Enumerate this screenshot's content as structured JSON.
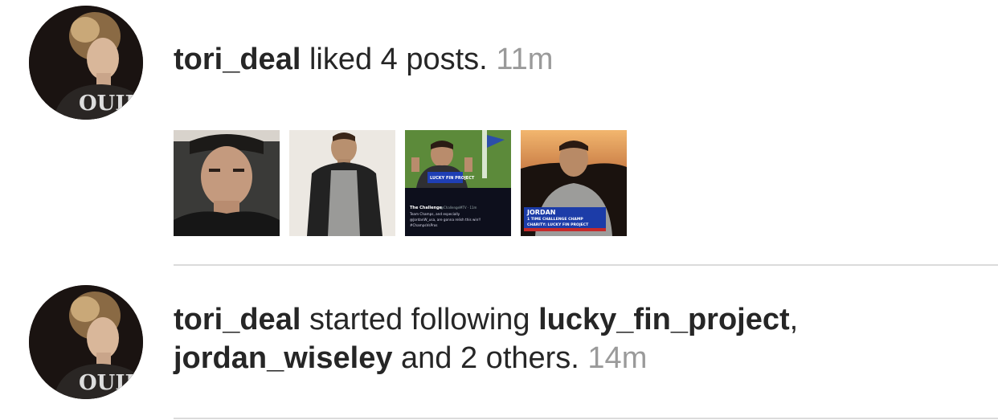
{
  "notifications": [
    {
      "username": "tori_deal",
      "action": "liked 4 posts.",
      "time": "11m",
      "avatar_icon": "profile-photo",
      "avatar_shirt_text": "OUIJ",
      "posts": [
        {
          "icon": "portrait-photo-1"
        },
        {
          "icon": "portrait-photo-2"
        },
        {
          "icon": "screenshot-photo-3",
          "banner": "LUCKY FIN PROJECT",
          "tweet_author": "The Challenge",
          "tweet_handle": "@ChallengeMTV · 11m",
          "tweet_line1": "Team Champs, and especially",
          "tweet_line2": "@JordanW_usa, are gonna relish this win!!",
          "tweet_line3": "#ChampsVsPros"
        },
        {
          "icon": "portrait-photo-4",
          "caption_name": "JORDAN",
          "caption_line1": "1 TIME CHALLENGE CHAMP",
          "caption_line2": "CHARITY: LUCKY FIN PROJECT"
        }
      ]
    },
    {
      "username": "tori_deal",
      "action": "started following",
      "target1": "lucky_fin_project",
      "comma": ",",
      "target2": "jordan_wiseley",
      "rest": "and 2 others.",
      "time": "14m",
      "avatar_icon": "profile-photo",
      "avatar_shirt_text": "OUIJ"
    }
  ],
  "colors": {
    "text": "#262626",
    "timestamp": "#9a9a9a",
    "divider": "#dbdbdb"
  }
}
